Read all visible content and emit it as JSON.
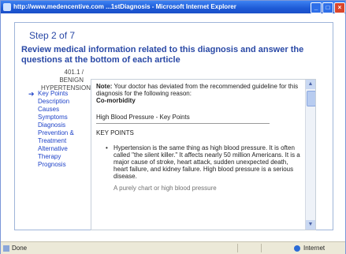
{
  "window": {
    "title": "http://www.medencentive.com ...1stDiagnosis - Microsoft Internet Explorer"
  },
  "wizard": {
    "step": "Step 2 of 7",
    "header": "Review medical information related to this diagnosis and answer the questions at the bottom of each article",
    "diagnosis": "401.1 / BENIGN HYPERTENSION"
  },
  "nav": {
    "items": [
      {
        "label": "Key Points"
      },
      {
        "label": "Description"
      },
      {
        "label": "Causes"
      },
      {
        "label": "Symptoms"
      },
      {
        "label": "Diagnosis"
      },
      {
        "label": "Prevention & Treatment"
      },
      {
        "label": "Alternative Therapy"
      },
      {
        "label": "Prognosis"
      }
    ]
  },
  "article": {
    "note_label": "Note:",
    "note_text": " Your doctor has deviated from the recommended guideline for this diagnosis for the following reason:",
    "reason": "Co-morbidity",
    "kp_title": "High Blood Pressure - Key Points",
    "kp_heading": "KEY POINTS",
    "bullet1": "Hypertension is the same thing as high blood pressure. It is often called \"the silent killer.\" It affects nearly 50 million Americans. It is a major cause of stroke, heart attack, sudden unexpected death, heart failure, and kidney failure. High blood pressure is a serious disease.",
    "bullet2": "A purely chart or high blood pressure"
  },
  "status": {
    "left": "Done",
    "right": "Internet"
  },
  "icons": {
    "nav_arrow": "arrow-right-icon",
    "window_close": "close-icon"
  }
}
